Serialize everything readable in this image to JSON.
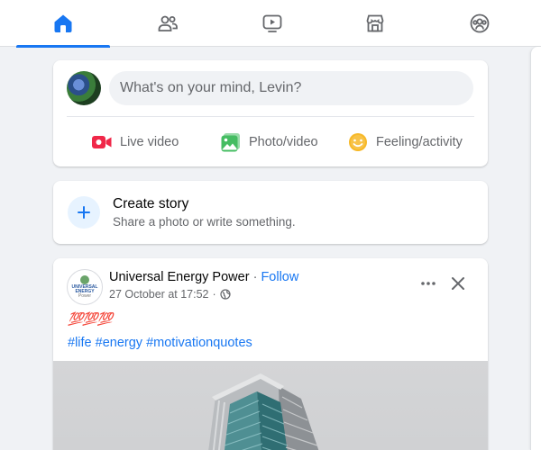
{
  "nav": {
    "tabs": [
      {
        "name": "home",
        "icon": "home-icon",
        "active": true
      },
      {
        "name": "friends",
        "icon": "friends-icon",
        "active": false
      },
      {
        "name": "watch",
        "icon": "video-icon",
        "active": false
      },
      {
        "name": "marketplace",
        "icon": "marketplace-icon",
        "active": false
      },
      {
        "name": "groups",
        "icon": "groups-icon",
        "active": false
      }
    ]
  },
  "composer": {
    "placeholder": "What's on your mind, Levin?",
    "actions": {
      "live": "Live video",
      "photo": "Photo/video",
      "feeling": "Feeling/activity"
    }
  },
  "story": {
    "title": "Create story",
    "subtitle": "Share a photo or write something."
  },
  "post": {
    "page_name": "Universal Energy Power",
    "separator": " · ",
    "follow": "Follow",
    "timestamp": "27 October at 17:52",
    "meta_separator": "·",
    "emoji_text": "💯💯💯",
    "hashtags": [
      "#life",
      "#energy",
      "#motivationquotes"
    ],
    "logo_text": [
      "UNIVERSAL",
      "ENERGY",
      "Power"
    ]
  },
  "colors": {
    "accent": "#1877f2",
    "live_red": "#f02849",
    "photo_green": "#45bd62",
    "feeling_yellow": "#f7b928",
    "background": "#f0f2f5"
  }
}
